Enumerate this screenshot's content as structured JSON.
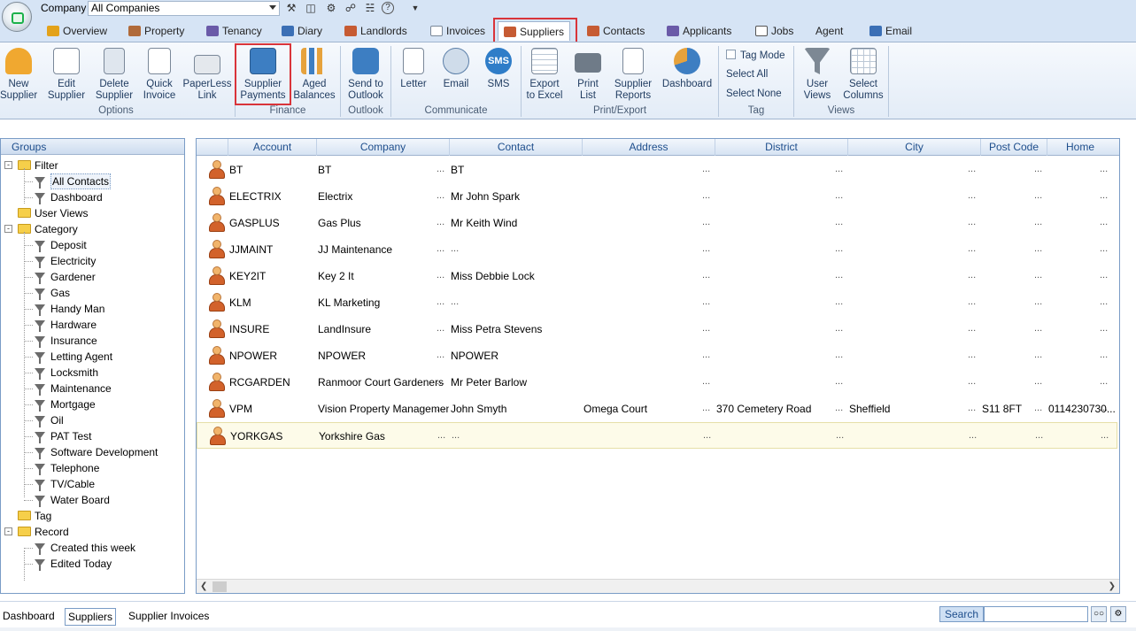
{
  "company": {
    "label": "Company",
    "value": "All Companies"
  },
  "tabs": [
    {
      "label": "Overview",
      "color": "#e3a21a"
    },
    {
      "label": "Property",
      "color": "#b06a3a"
    },
    {
      "label": "Tenancy",
      "color": "#6a5aa8"
    },
    {
      "label": "Diary",
      "color": "#3b6fb5"
    },
    {
      "label": "Landlords",
      "color": "#c65b33"
    },
    {
      "label": "Invoices",
      "color": "#7a8899"
    },
    {
      "label": "Suppliers",
      "color": "#c65b33"
    },
    {
      "label": "Contacts",
      "color": "#c65b33"
    },
    {
      "label": "Applicants",
      "color": "#6a5aa8"
    },
    {
      "label": "Jobs",
      "color": "#555555"
    },
    {
      "label": "Agent",
      "color": "#555555"
    },
    {
      "label": "Email",
      "color": "#3b6fb5"
    }
  ],
  "active_tab": "Suppliers",
  "ribbon": {
    "new_supplier": [
      "New",
      "Supplier"
    ],
    "edit_supplier": [
      "Edit",
      "Supplier"
    ],
    "delete_supplier": [
      "Delete",
      "Supplier"
    ],
    "quick_invoice": [
      "Quick",
      "Invoice"
    ],
    "paperless_link": [
      "PaperLess",
      "Link"
    ],
    "supplier_payments": [
      "Supplier",
      "Payments"
    ],
    "aged_balances": [
      "Aged",
      "Balances"
    ],
    "send_to_outlook": [
      "Send to",
      "Outlook"
    ],
    "letter": "Letter",
    "email": "Email",
    "sms": "SMS",
    "sms_icon_text": "SMS",
    "export_to_excel": [
      "Export",
      "to Excel"
    ],
    "print_list": [
      "Print",
      "List"
    ],
    "supplier_reports": [
      "Supplier",
      "Reports"
    ],
    "dashboard": "Dashboard",
    "tag_mode": "Tag Mode",
    "select_all": "Select All",
    "select_none": "Select None",
    "user_views": [
      "User",
      "Views"
    ],
    "select_columns": [
      "Select",
      "Columns"
    ],
    "groups": {
      "options": "Options",
      "finance": "Finance",
      "outlook": "Outlook",
      "communicate": "Communicate",
      "print_export": "Print/Export",
      "tag": "Tag",
      "views": "Views"
    }
  },
  "groups_panel": {
    "title": "Groups",
    "filter": {
      "label": "Filter",
      "items": [
        "All Contacts",
        "Dashboard"
      ]
    },
    "user_views": "User Views",
    "category": {
      "label": "Category",
      "items": [
        "Deposit",
        "Electricity",
        "Gardener",
        "Gas",
        "Handy Man",
        "Hardware",
        "Insurance",
        "Letting Agent",
        "Locksmith",
        "Maintenance",
        "Mortgage",
        "Oil",
        "PAT Test",
        "Software Development",
        "Telephone",
        "TV/Cable",
        "Water Board"
      ]
    },
    "tag": "Tag",
    "record": {
      "label": "Record",
      "items": [
        "Created this week",
        "Edited Today"
      ]
    }
  },
  "grid": {
    "columns": [
      "Account",
      "Company",
      "Contact",
      "Address",
      "District",
      "City",
      "Post Code",
      "Home"
    ],
    "ellipsis": "...",
    "rows": [
      {
        "account": "BT",
        "company": "BT",
        "contact": "BT",
        "address": "",
        "district": "",
        "city": "",
        "postcode": "",
        "home": ""
      },
      {
        "account": "ELECTRIX",
        "company": "Electrix",
        "contact": "Mr John Spark",
        "address": "",
        "district": "",
        "city": "",
        "postcode": "",
        "home": ""
      },
      {
        "account": "GASPLUS",
        "company": "Gas Plus",
        "contact": "Mr Keith Wind",
        "address": "",
        "district": "",
        "city": "",
        "postcode": "",
        "home": ""
      },
      {
        "account": "JJMAINT",
        "company": "JJ Maintenance",
        "contact": "",
        "address": "",
        "district": "",
        "city": "",
        "postcode": "",
        "home": ""
      },
      {
        "account": "KEY2IT",
        "company": "Key 2 It",
        "contact": "Miss Debbie Lock",
        "address": "",
        "district": "",
        "city": "",
        "postcode": "",
        "home": ""
      },
      {
        "account": "KLM",
        "company": "KL Marketing",
        "contact": "",
        "address": "",
        "district": "",
        "city": "",
        "postcode": "",
        "home": ""
      },
      {
        "account": "INSURE",
        "company": "LandInsure",
        "contact": "Miss Petra Stevens",
        "address": "",
        "district": "",
        "city": "",
        "postcode": "",
        "home": ""
      },
      {
        "account": "NPOWER",
        "company": "NPOWER",
        "contact": "NPOWER",
        "address": "",
        "district": "",
        "city": "",
        "postcode": "",
        "home": ""
      },
      {
        "account": "RCGARDEN",
        "company": "Ranmoor Court Gardeners",
        "contact": "Mr Peter Barlow",
        "address": "",
        "district": "",
        "city": "",
        "postcode": "",
        "home": ""
      },
      {
        "account": "VPM",
        "company": "Vision Property Management...",
        "contact": "John Smyth",
        "address": "Omega Court",
        "district": "370 Cemetery Road",
        "city": "Sheffield",
        "postcode": "S11 8FT",
        "home": "0114230730..."
      },
      {
        "account": "YORKGAS",
        "company": "Yorkshire Gas",
        "contact": "",
        "address": "",
        "district": "",
        "city": "",
        "postcode": "",
        "home": ""
      }
    ],
    "selected_row": 10
  },
  "bottom_tabs": [
    "Dashboard",
    "Suppliers",
    "Supplier Invoices"
  ],
  "active_bottom_tab": "Suppliers",
  "search": {
    "label": "Search",
    "placeholder": ""
  },
  "highlight_color": "#d9343a"
}
